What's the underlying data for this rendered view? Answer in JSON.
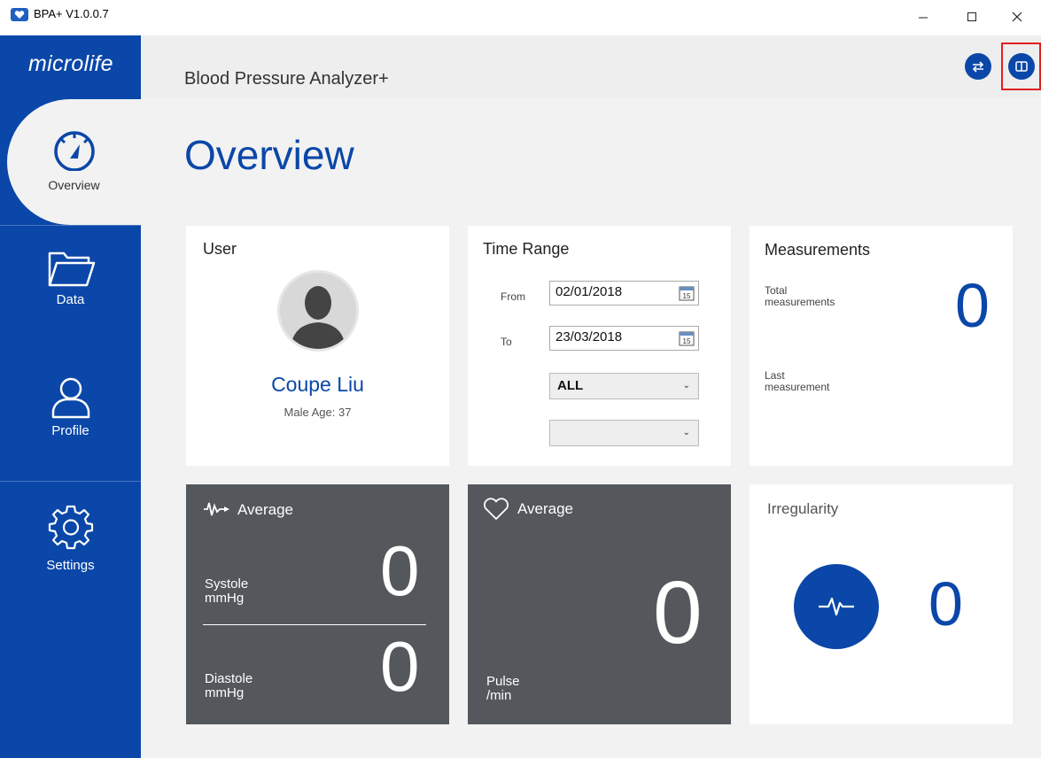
{
  "window": {
    "title": "BPA+ V1.0.0.7",
    "minimize_icon": "minimize-icon",
    "maximize_icon": "maximize-icon",
    "close_icon": "close-icon"
  },
  "sidebar": {
    "logo": "microlife",
    "items": [
      {
        "label": "Overview",
        "icon": "speedometer-icon",
        "active": true
      },
      {
        "label": "Data",
        "icon": "folder-icon",
        "active": false
      },
      {
        "label": "Profile",
        "icon": "user-icon",
        "active": false
      },
      {
        "label": "Settings",
        "icon": "gear-icon",
        "active": false
      }
    ]
  },
  "header": {
    "title": "Blood Pressure Analyzer+",
    "buttons": [
      {
        "icon": "swap-icon"
      },
      {
        "icon": "book-icon"
      }
    ]
  },
  "main": {
    "title": "Overview",
    "user": {
      "title": "User",
      "name": "Coupe Liu",
      "meta": "Male  Age: 37"
    },
    "time_range": {
      "title": "Time Range",
      "from_label": "From",
      "from_value": "02/01/2018",
      "to_label": "To",
      "to_value": "23/03/2018",
      "calendar_day": "15",
      "select1_value": "ALL",
      "select2_value": ""
    },
    "measurements": {
      "title": "Measurements",
      "total_label_1": "Total",
      "total_label_2": "measurements",
      "total_value": "0",
      "last_label_1": "Last",
      "last_label_2": "measurement"
    },
    "bp_average": {
      "title": "Average",
      "systole_label_1": "Systole",
      "systole_label_2": "mmHg",
      "systole_value": "0",
      "diastole_label_1": "Diastole",
      "diastole_label_2": "mmHg",
      "diastole_value": "0"
    },
    "pulse_average": {
      "title": "Average",
      "pulse_label_1": "Pulse",
      "pulse_label_2": "/min",
      "pulse_value": "0"
    },
    "irregularity": {
      "title": "Irregularity",
      "value": "0"
    }
  },
  "colors": {
    "brand_blue": "#0a47a8",
    "dark_card": "#54575b",
    "highlight": "#e02020"
  }
}
